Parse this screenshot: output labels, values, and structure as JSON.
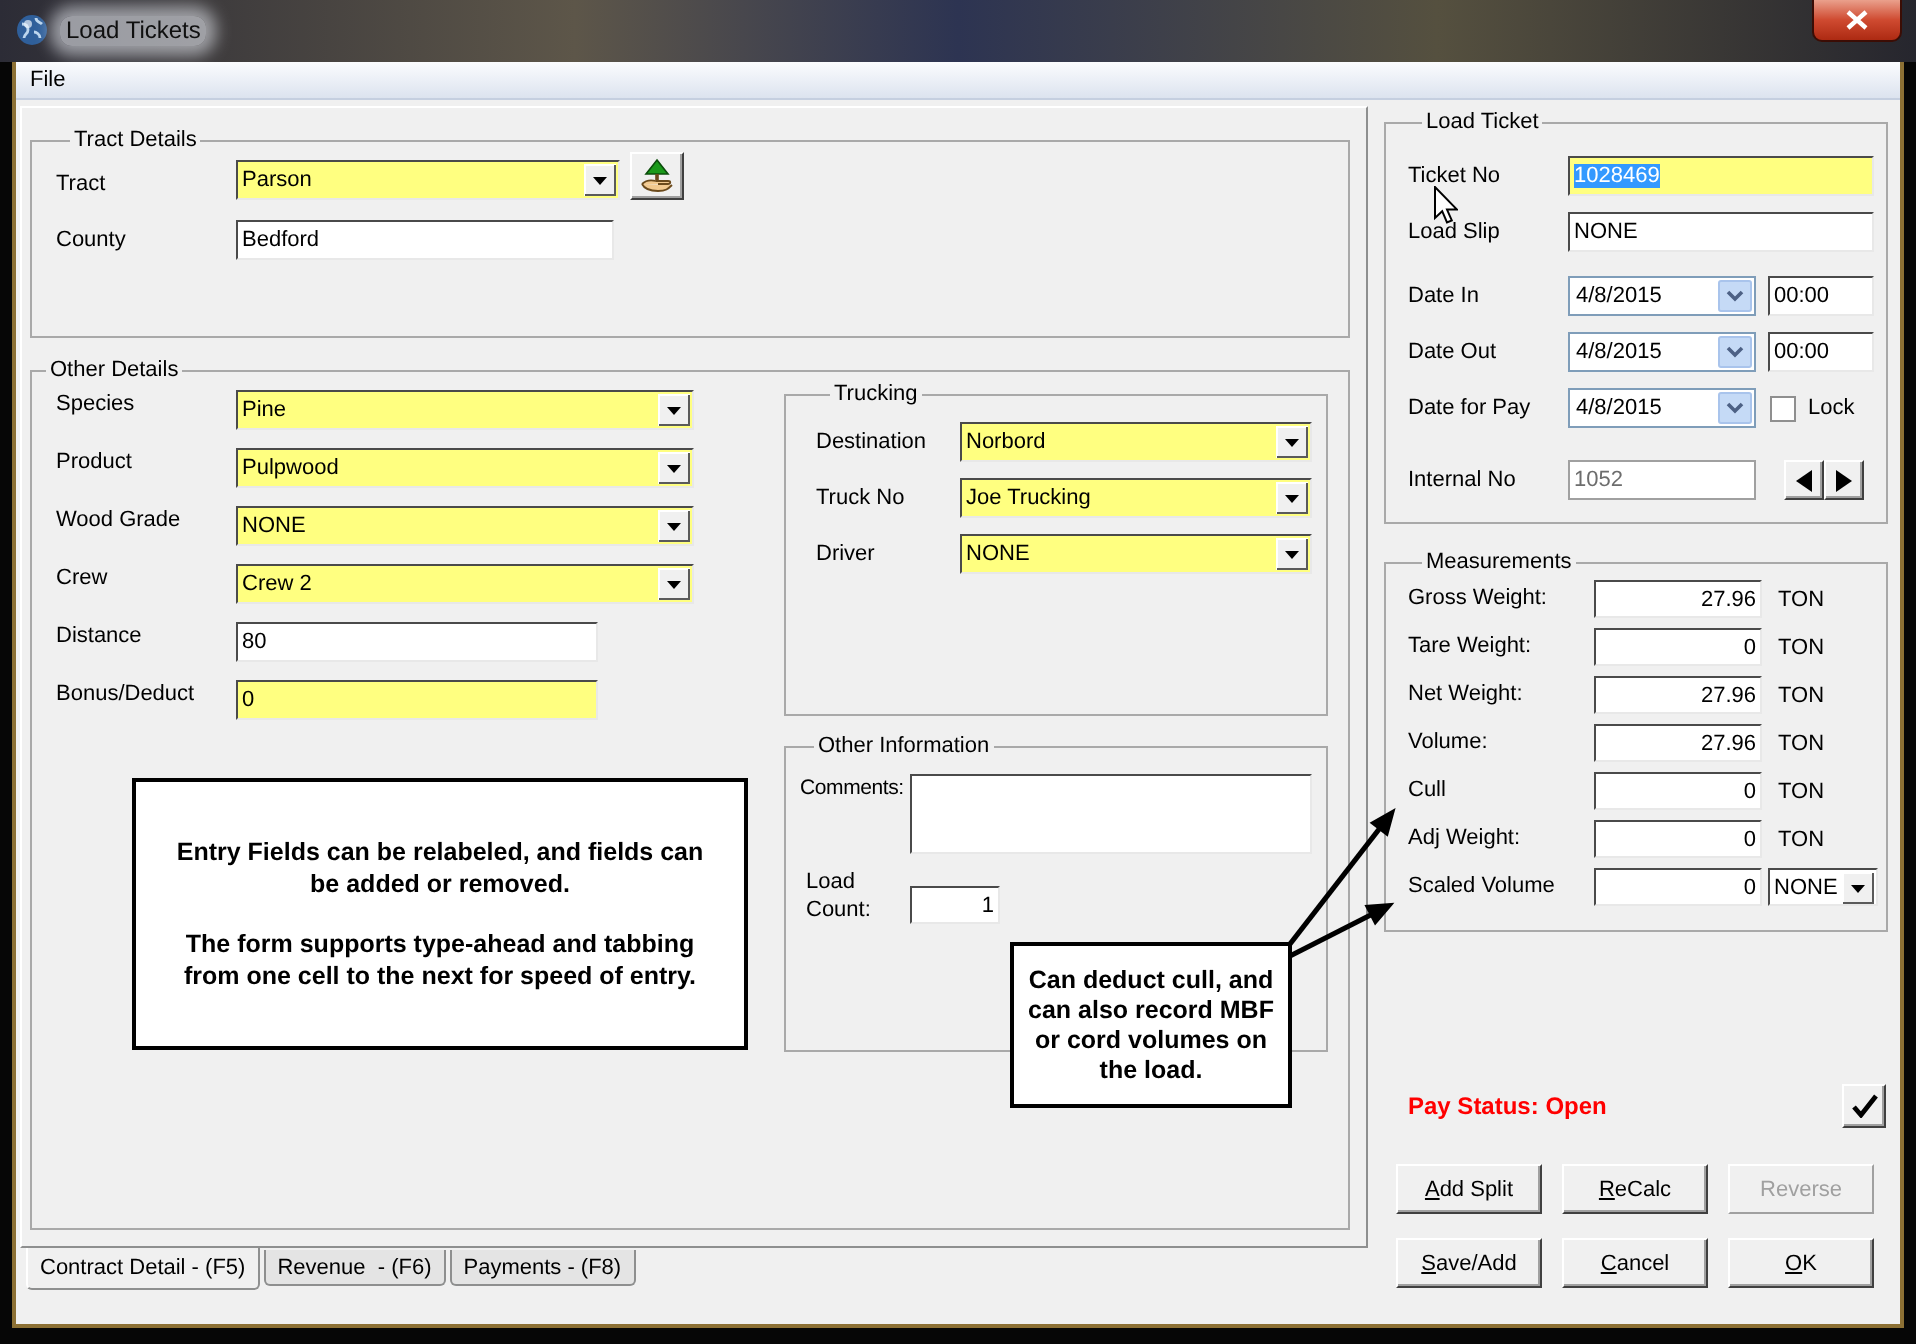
{
  "window": {
    "title": "Load Tickets"
  },
  "menu": [
    {
      "label": "File"
    }
  ],
  "tract_details": {
    "title": "Tract Details",
    "fields": [
      {
        "label": "Tract",
        "kind": "combo",
        "value": "Parson",
        "highlighted": true,
        "lookup_button": true
      },
      {
        "label": "County",
        "kind": "text",
        "value": "Bedford",
        "highlighted": false,
        "lookup_button": false
      }
    ]
  },
  "other_details": {
    "title": "Other Details",
    "fields": [
      {
        "label": "Species",
        "kind": "combo",
        "value": "Pine",
        "highlighted": true
      },
      {
        "label": "Product",
        "kind": "combo",
        "value": "Pulpwood",
        "highlighted": true
      },
      {
        "label": "Wood Grade",
        "kind": "combo",
        "value": "NONE",
        "highlighted": true
      },
      {
        "label": "Crew",
        "kind": "combo",
        "value": "Crew 2",
        "highlighted": true
      },
      {
        "label": "Distance",
        "kind": "text",
        "value": "80",
        "highlighted": false
      },
      {
        "label": "Bonus/Deduct",
        "kind": "text",
        "value": "0",
        "highlighted": true
      }
    ]
  },
  "trucking": {
    "title": "Trucking",
    "fields": [
      {
        "label": "Destination",
        "kind": "combo",
        "value": "Norbord",
        "highlighted": true
      },
      {
        "label": "Truck No",
        "kind": "combo",
        "value": "Joe Trucking",
        "highlighted": true
      },
      {
        "label": "Driver",
        "kind": "combo",
        "value": "NONE",
        "highlighted": true
      }
    ]
  },
  "other_information": {
    "title": "Other Information",
    "fields": [
      {
        "label": "Comments:",
        "kind": "memo"
      },
      {
        "label": "Load Count:",
        "kind": "number",
        "value": "1"
      }
    ]
  },
  "load_ticket": {
    "title": "Load Ticket",
    "rows": [
      {
        "label": "Ticket No",
        "kind": "text",
        "value": "1028469",
        "highlighted": true,
        "text_selected": true
      },
      {
        "label": "Load Slip",
        "kind": "text",
        "value": "NONE",
        "highlighted": false,
        "text_selected": false
      },
      {
        "label": "Date In",
        "kind": "date",
        "value": "4/8/2015",
        "time": "00:00"
      },
      {
        "label": "Date Out",
        "kind": "date",
        "value": "4/8/2015",
        "time": "00:00"
      },
      {
        "label": "Date for Pay",
        "kind": "date",
        "value": "4/8/2015",
        "lock": {
          "label": "Lock",
          "checked": false
        }
      },
      {
        "label": "Internal No",
        "kind": "readonly",
        "value": "1052",
        "disabled": true
      }
    ]
  },
  "measurements": {
    "title": "Measurements",
    "rows": [
      {
        "label": "Gross Weight:",
        "kind": "unit",
        "value": "27.96",
        "unit": "TON"
      },
      {
        "label": "Tare Weight:",
        "kind": "unit",
        "value": "0",
        "unit": "TON"
      },
      {
        "label": "Net Weight:",
        "kind": "unit",
        "value": "27.96",
        "unit": "TON"
      },
      {
        "label": "Volume:",
        "kind": "unit",
        "value": "27.96",
        "unit": "TON"
      },
      {
        "label": "Cull",
        "kind": "unit",
        "value": "0",
        "unit": "TON"
      },
      {
        "label": "Adj Weight:",
        "kind": "unit",
        "value": "0",
        "unit": "TON"
      },
      {
        "label": "Scaled Volume",
        "kind": "unit-combo",
        "value": "0",
        "unit": "NONE"
      }
    ]
  },
  "pay_status": {
    "text": "Pay Status: Open"
  },
  "buttons": [
    {
      "label": "Add Split",
      "underline_first": true,
      "disabled": false
    },
    {
      "label": "ReCalc",
      "underline_first": true,
      "disabled": false
    },
    {
      "label": "Reverse",
      "underline_first": false,
      "disabled": true
    },
    {
      "label": "Save/Add",
      "underline_first": true,
      "disabled": false
    },
    {
      "label": "Cancel",
      "underline_first": true,
      "disabled": false
    },
    {
      "label": "OK",
      "underline_first": true,
      "disabled": false
    }
  ],
  "tabs": [
    {
      "label": "Contract Detail - (F5)",
      "selected": true
    },
    {
      "label": "Revenue  - (F6)",
      "selected": false
    },
    {
      "label": "Payments - (F8)",
      "selected": false
    }
  ],
  "callouts": [
    {
      "paragraphs": [
        "Entry Fields can be relabeled, and fields can be added or removed.",
        "The form supports type-ahead and tabbing from one cell to the next for speed of entry."
      ]
    },
    {
      "paragraphs": [
        "Can deduct cull, and can also record MBF or cord volumes on the load."
      ]
    }
  ]
}
